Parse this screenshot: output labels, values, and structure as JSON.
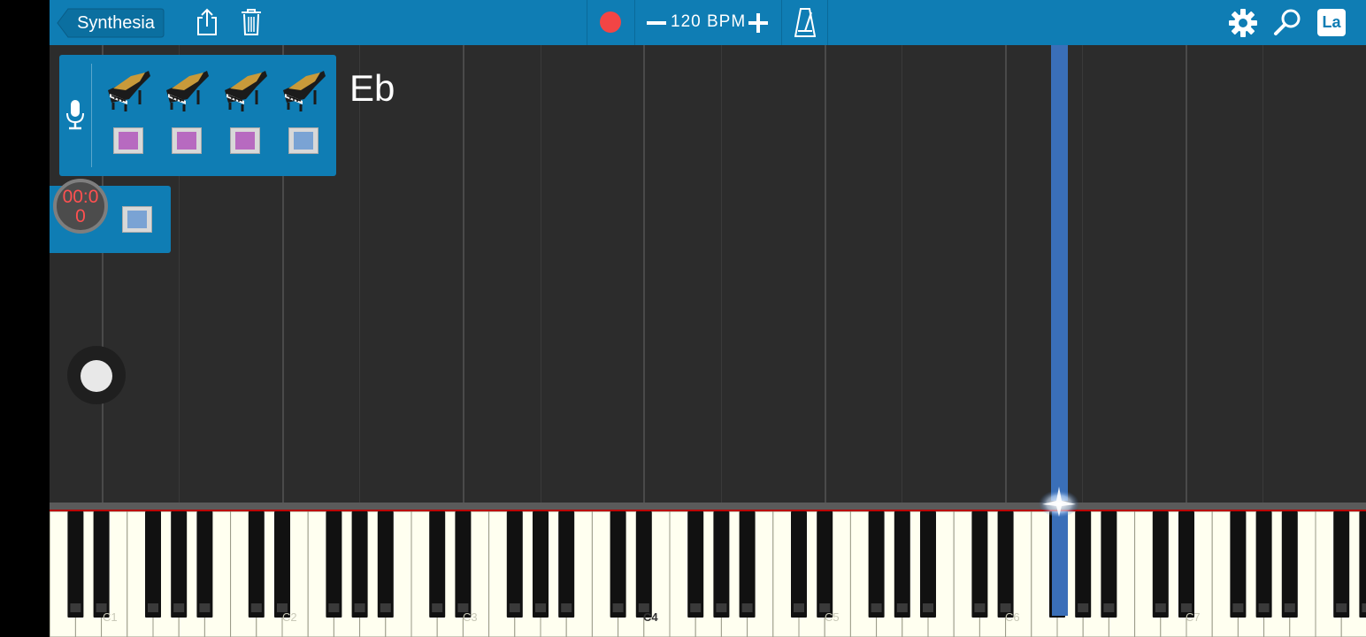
{
  "topbar": {
    "back_label": "Synthesia",
    "bpm": "120 BPM",
    "lang_label": "La"
  },
  "key_label": "Eb",
  "timer": "00:00",
  "octave_labels": [
    "C1",
    "C2",
    "C3",
    "C4",
    "C5",
    "C6",
    "C7"
  ],
  "tracks": [
    {
      "color": "#b76ac0"
    },
    {
      "color": "#b76ac0"
    },
    {
      "color": "#b76ac0"
    },
    {
      "color": "#7aa3d4"
    }
  ],
  "extra_track_color": "#7aa3d4",
  "colors": {
    "topbar": "#0f7db4",
    "record": "#f24545",
    "note_highlight": "#3a6fb8"
  }
}
